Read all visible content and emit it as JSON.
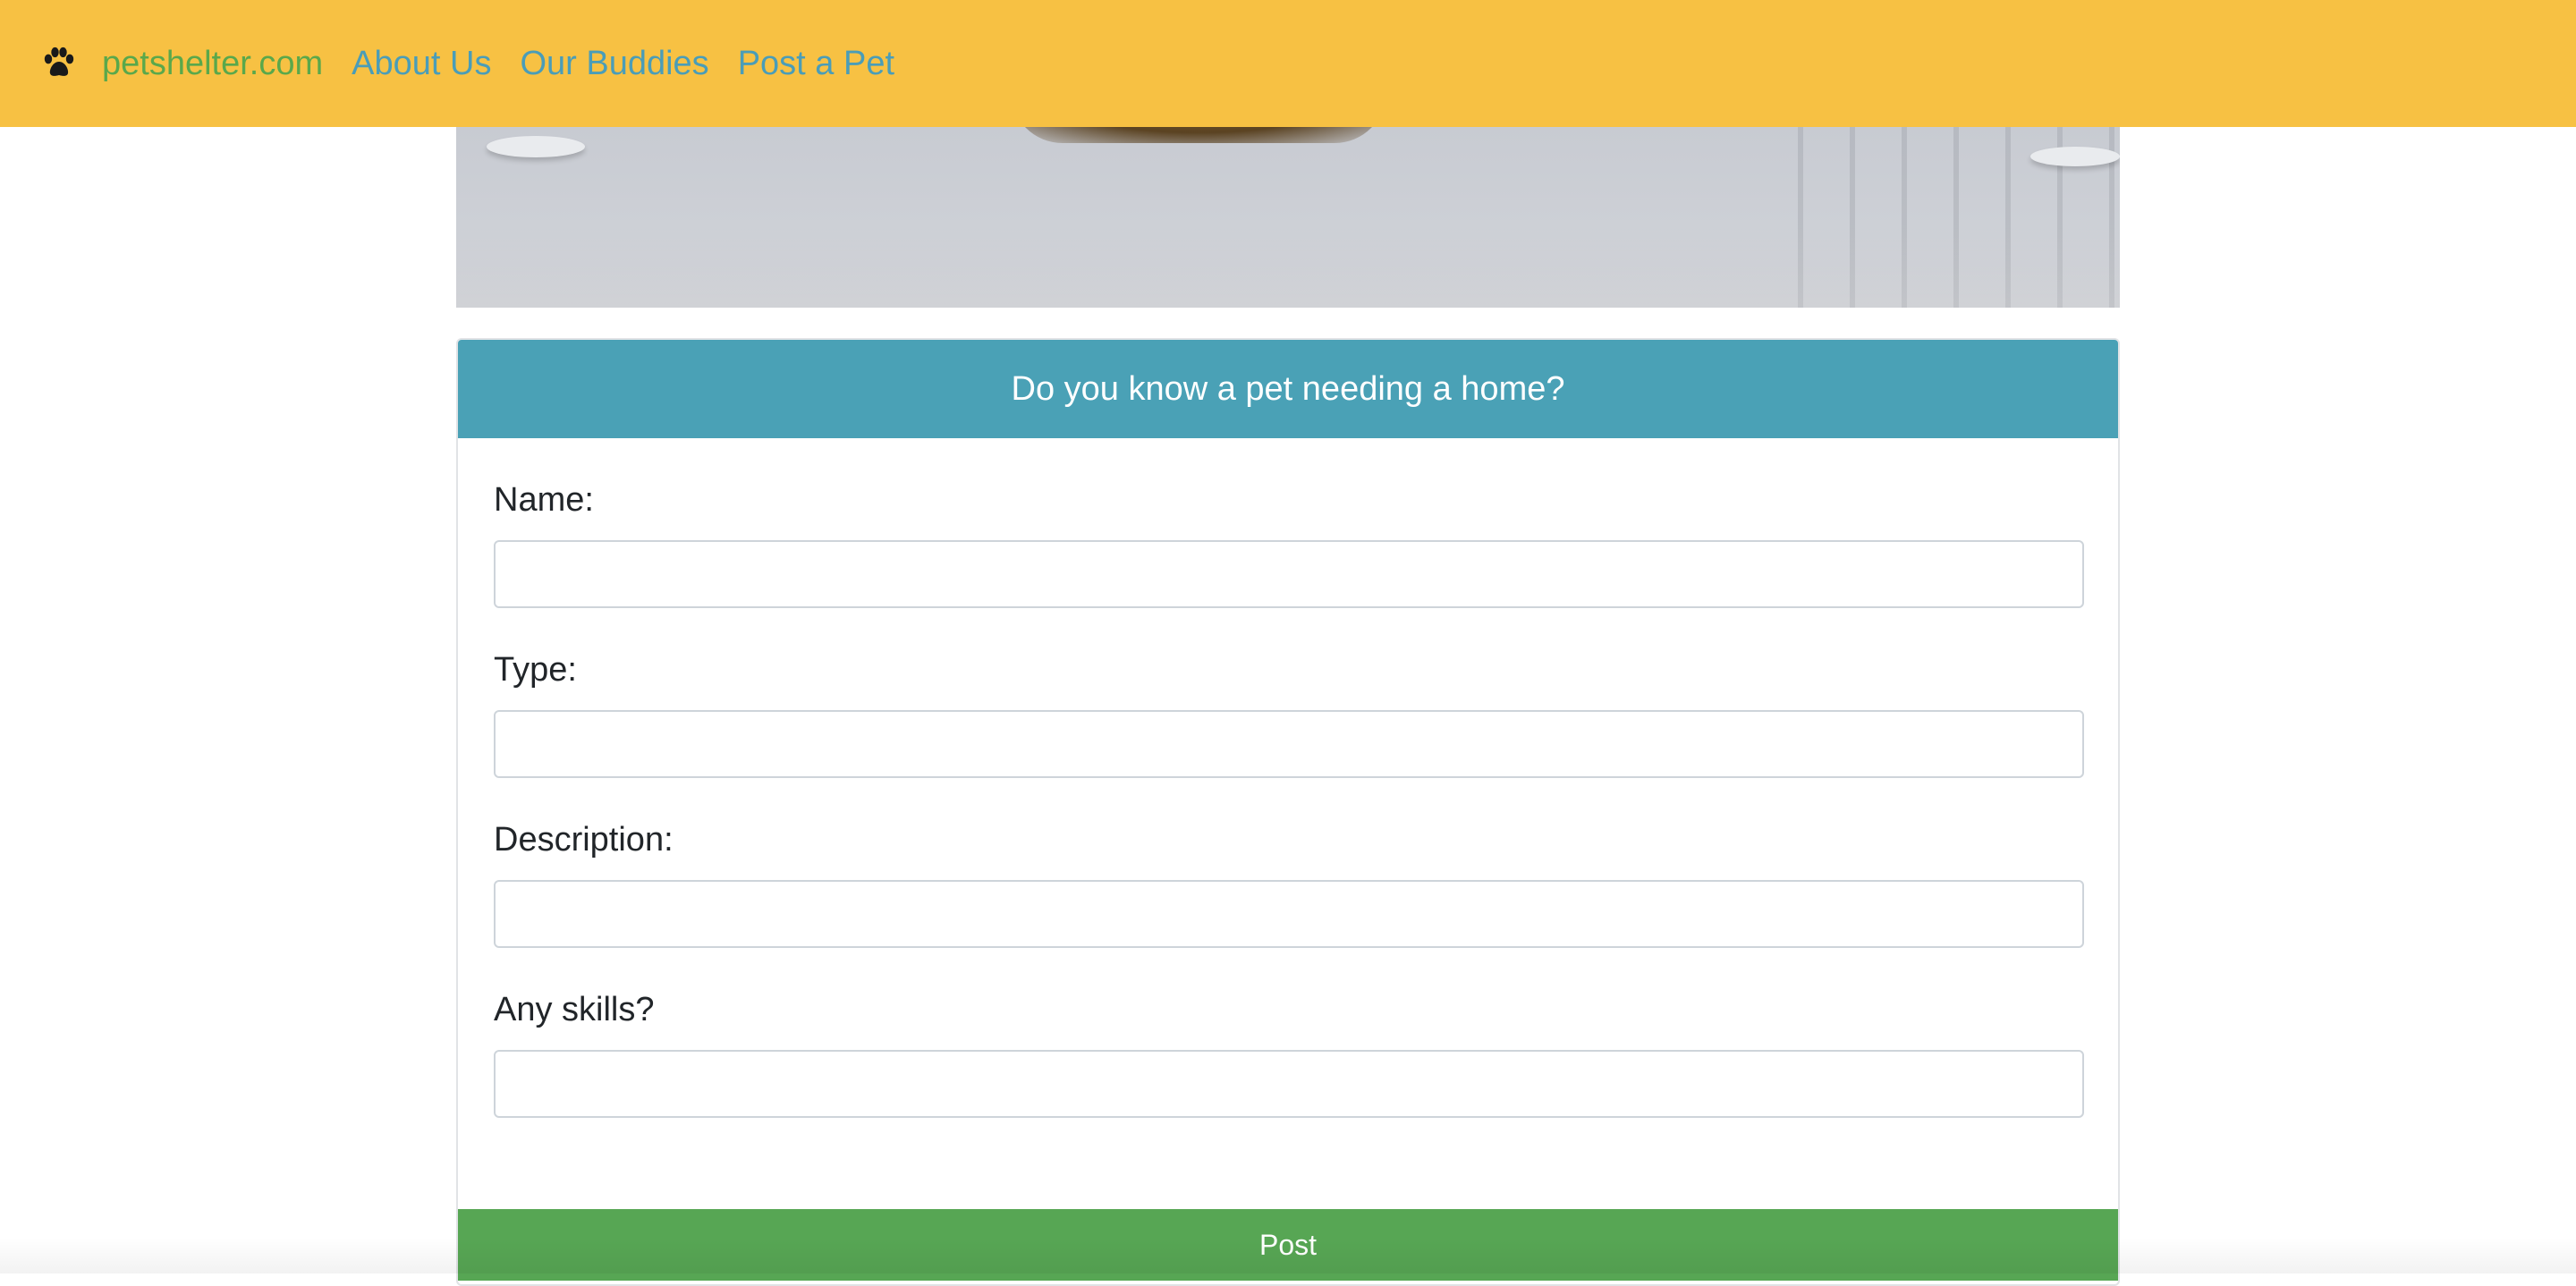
{
  "navbar": {
    "logo_icon": "paw-icon",
    "brand": "petshelter.com",
    "links": [
      "About Us",
      "Our Buddies",
      "Post a Pet"
    ],
    "background_color": "#f7c143",
    "brand_color": "#5aa84b",
    "link_color": "#4a9db8"
  },
  "form": {
    "header": "Do you know a pet needing a home?",
    "header_color": "#4aa1b6",
    "fields": [
      {
        "label": "Name:",
        "value": ""
      },
      {
        "label": "Type:",
        "value": ""
      },
      {
        "label": "Description:",
        "value": ""
      },
      {
        "label": "Any skills?",
        "value": ""
      }
    ],
    "submit_label": "Post",
    "submit_color": "#57a654"
  }
}
